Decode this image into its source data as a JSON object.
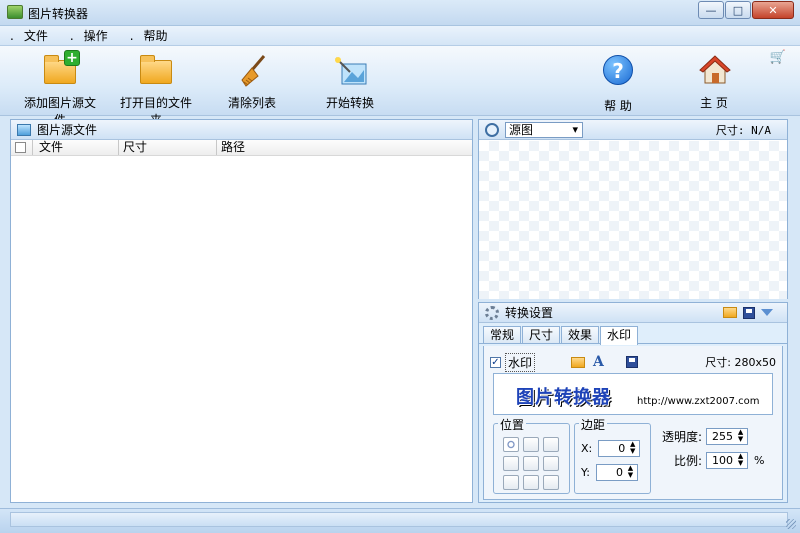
{
  "window": {
    "title": "图片转换器"
  },
  "menu": [
    "文件",
    "操作",
    "帮助"
  ],
  "toolbar": {
    "add_label": "添加图片源文件",
    "open_label": "打开目的文件夹",
    "clear_label": "清除列表",
    "start_label": "开始转换",
    "help_label": "帮 助",
    "home_label": "主 页"
  },
  "left": {
    "title": "图片源文件",
    "columns": [
      "文件",
      "尺寸",
      "路径"
    ]
  },
  "preview": {
    "source_value": "源图",
    "size_label": "尺寸: N/A"
  },
  "settings": {
    "title": "转换设置",
    "tabs": [
      "常规",
      "尺寸",
      "效果",
      "水印"
    ],
    "active_tab": "水印",
    "watermark": {
      "enabled_label": "水印",
      "size_label": "尺寸: 280x50",
      "preview_text": "图片转换器",
      "preview_url": "http://www.zxt2007.com"
    },
    "position_title": "位置",
    "margin_title": "边距",
    "x_label": "X:",
    "x_value": "0",
    "y_label": "Y:",
    "y_value": "0",
    "opacity_label": "透明度:",
    "opacity_value": "255",
    "scale_label": "比例:",
    "scale_value": "100",
    "scale_unit": "%"
  },
  "colors": {
    "accent": "#1e43b8",
    "panel_border": "#8fb1d6",
    "background": "#d6e7f7"
  }
}
